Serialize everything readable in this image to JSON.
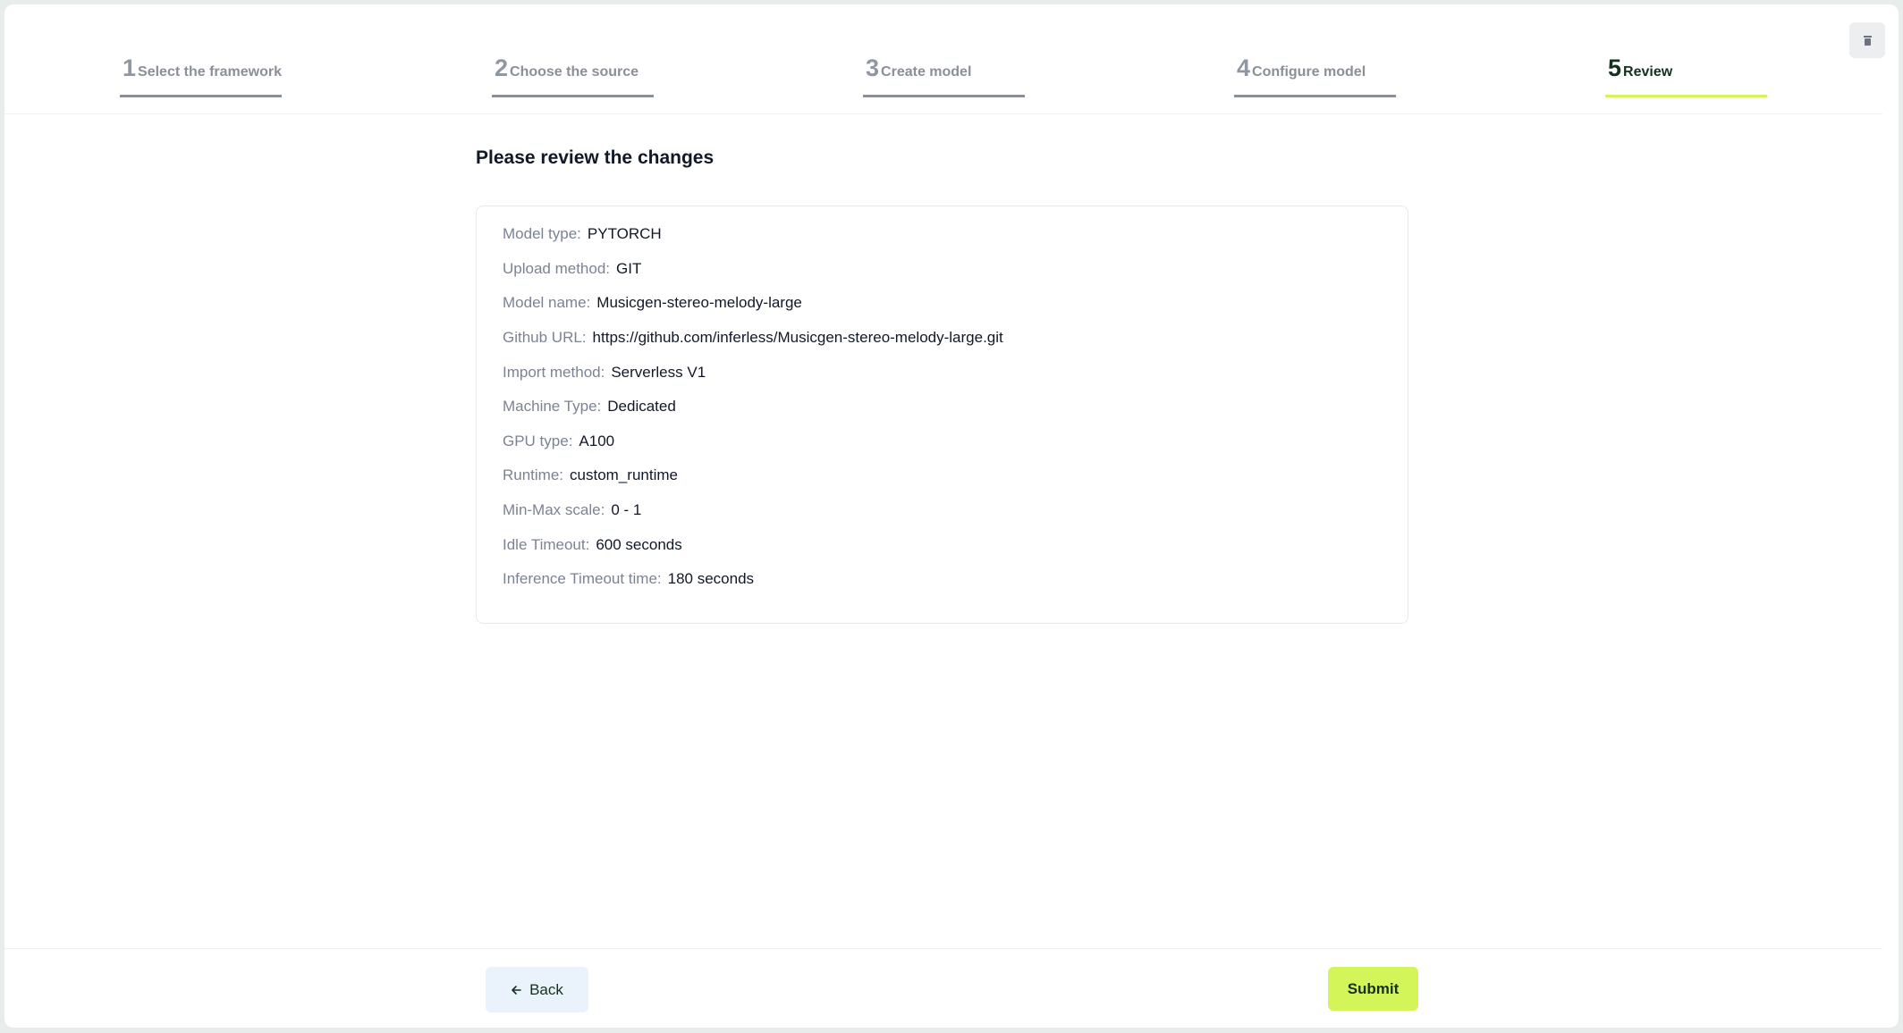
{
  "stepper": {
    "steps": [
      {
        "number": "1",
        "label": "Select the framework",
        "active": false
      },
      {
        "number": "2",
        "label": "Choose the source",
        "active": false
      },
      {
        "number": "3",
        "label": "Create model",
        "active": false
      },
      {
        "number": "4",
        "label": "Configure model",
        "active": false
      },
      {
        "number": "5",
        "label": "Review",
        "active": true
      }
    ],
    "accent_color": "#d4f55a",
    "inactive_color": "#8a8f98"
  },
  "header": {
    "corner_icon": "trash-icon"
  },
  "review": {
    "title": "Please review the changes",
    "items": [
      {
        "key": "Model type:",
        "value": "PYTORCH"
      },
      {
        "key": "Upload method:",
        "value": "GIT"
      },
      {
        "key": "Model name:",
        "value": "Musicgen-stereo-melody-large"
      },
      {
        "key": "Github URL:",
        "value": "https://github.com/inferless/Musicgen-stereo-melody-large.git"
      },
      {
        "key": "Import method:",
        "value": "Serverless V1"
      },
      {
        "key": "Machine Type:",
        "value": "Dedicated"
      },
      {
        "key": "GPU type:",
        "value": "A100"
      },
      {
        "key": "Runtime:",
        "value": "custom_runtime"
      },
      {
        "key": "Min-Max scale:",
        "value": "0 - 1"
      },
      {
        "key": "Idle Timeout:",
        "value": "600 seconds"
      },
      {
        "key": "Inference Timeout time:",
        "value": "180 seconds"
      }
    ]
  },
  "footer": {
    "back_label": "Back",
    "back_icon": "arrow-left-icon",
    "submit_label": "Submit"
  }
}
